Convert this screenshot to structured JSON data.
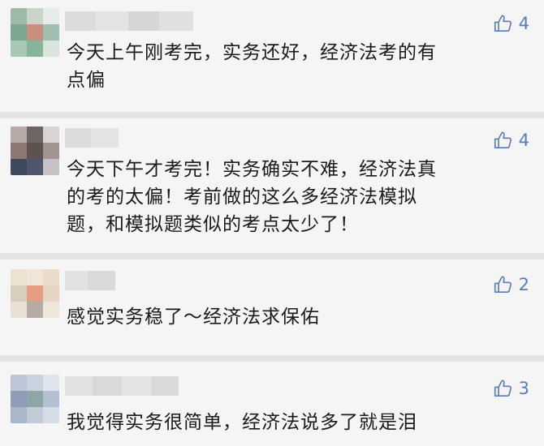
{
  "comments": [
    {
      "likes": "4",
      "text": "今天上午刚考完，实务还好，经济法考的有\n点偏"
    },
    {
      "likes": "4",
      "text": "今天下午才考完！实务确实不难，经济法真\n的考的太偏！考前做的这么多经济法模拟\n题，和模拟题类似的考点太少了！"
    },
    {
      "likes": "2",
      "text": "感觉实务稳了～经济法求保佑"
    },
    {
      "likes": "3",
      "text": "我觉得实务很简单，经济法说多了就是泪"
    }
  ],
  "colors": {
    "like_icon": "#5b7bb5",
    "card_bg": "#f5f5f5",
    "separator": "#e3e3e3"
  },
  "icons": {
    "like": "thumbs-up-icon"
  }
}
